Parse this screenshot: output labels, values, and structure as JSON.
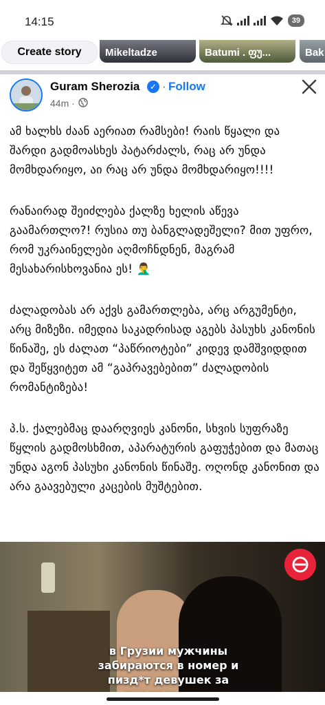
{
  "status_bar": {
    "time": "14:15",
    "battery": "39"
  },
  "stories": {
    "create_label": "Create story",
    "items": [
      {
        "label": "Mikeltadze"
      },
      {
        "label": "Batumi . ფუ..."
      },
      {
        "label": "Bak"
      }
    ]
  },
  "post": {
    "author": "Guram Sherozia",
    "follow_label": "Follow",
    "separator": "·",
    "time": "44m ·",
    "paragraphs": [
      "ამ ხალხს ძაან აერიათ რამსები! რაის წყალი და შარდი გადმოასხეს პატარძალს, რაც არ უნდა მომხდარიყო, აი რაც არ უნდა მომხდარიყო!!!!",
      "რანაირად შეიძლება ქალზე ხელის აწევა გაამართლო?! რუსია თუ ბანგლადეშელი? მით უფრო, რომ უკრაინელები აღმოჩნდნენ, მაგრამ მესახარისხოვანია ეს! 🤦‍♂️",
      "ძალადობას არ აქვს გამართლება, არც არგუმენტი, არც მიზეზი. იმედია საკადრისად აგებს პასუხს კანონის წინაშე, ეს ძალათ “პაწრიოტები” კიდევ დამშვიდდით და შეწყვიტეთ ამ “გაპრავებებით” ძალადობის რომანტიზება!",
      "პ.ს. ქალებმაც დაარღვიეს კანონი, სხვის სუფრაზე წყლის გადმოსხმით, აპარატურის გაფუჭებით და მათაც უნდა აგონ პასუხი კანონის წინაშე. ოღონდ კანონით და არა გაავებული კაცების მუშტებით."
    ]
  },
  "video": {
    "caption": "в Грузии мужчины забираются в номер и пизд*т девушек за русскую речь"
  },
  "colors": {
    "accent": "#1877f2",
    "text": "#050505",
    "secondary": "#65676b"
  },
  "icons": [
    "dnd-icon",
    "signal-icon",
    "wifi-icon",
    "battery-icon",
    "verified-icon",
    "globe-icon",
    "close-icon",
    "app-logo-icon"
  ]
}
